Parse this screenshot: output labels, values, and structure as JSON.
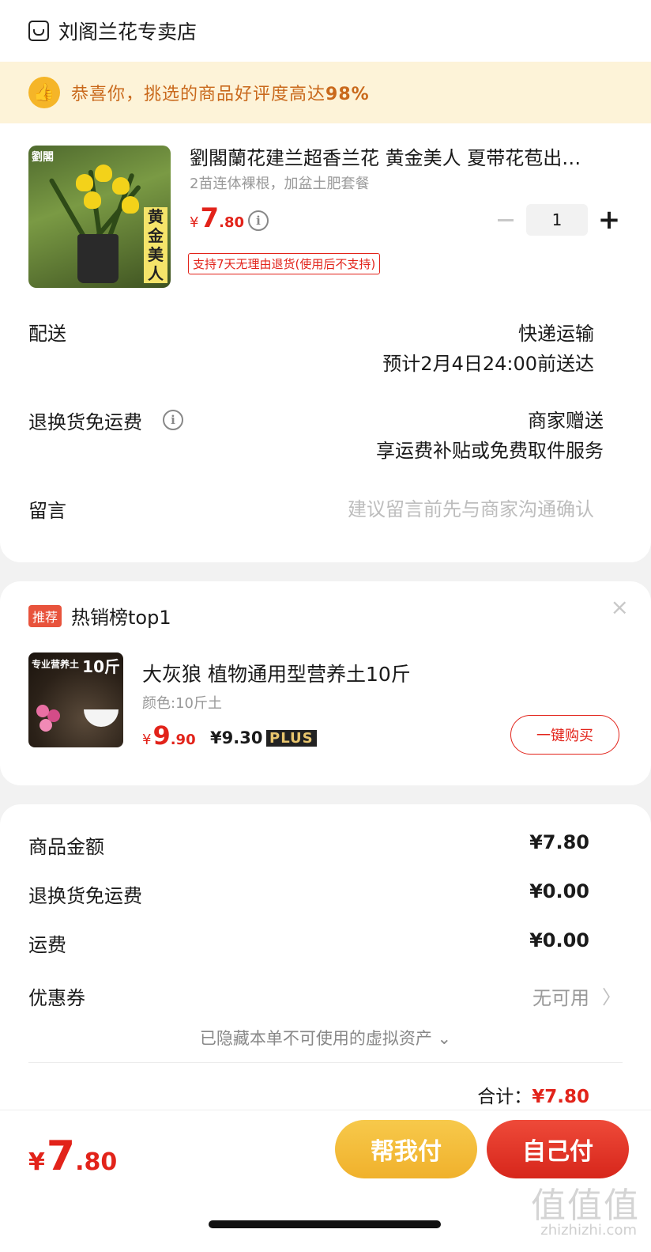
{
  "store": {
    "name": "刘阁兰花专卖店",
    "icon": "store-icon"
  },
  "praise": {
    "text": "恭喜你，挑选的商品好评度高达",
    "percent": "98%",
    "icon": "thumbs-up-icon"
  },
  "product": {
    "title": "劉閣蘭花建兰超香兰花 黄金美人 夏带花苞出…",
    "spec": "2苗连体裸根，加盆土肥套餐",
    "image_logo": "劉閣",
    "image_side_text": "黄金美人",
    "price_yen": "¥",
    "price_int": "7",
    "price_dec": ".80",
    "quantity": "1",
    "return_tag": "支持7天无理由退货(使用后不支持)"
  },
  "delivery": {
    "label": "配送",
    "method": "快递运输",
    "eta": "预计2月4日24:00前送达"
  },
  "return_shipping": {
    "label": "退换货免运费",
    "gift": "商家赠送",
    "desc": "享运费补贴或免费取件服务"
  },
  "message": {
    "label": "留言",
    "placeholder": "建议留言前先与商家沟通确认"
  },
  "recommend": {
    "badge": "推荐",
    "title": "热销榜top1",
    "close": "×",
    "image_banner": "专业营养土",
    "image_big": "10斤",
    "name": "大灰狼 植物通用型营养土10斤",
    "color": "颜色:10斤土",
    "price_yen": "¥",
    "price_int": "9",
    "price_dec": ".90",
    "plus_price": "¥9.30",
    "plus_label": "PLUS",
    "buy_label": "一键购买"
  },
  "summary": {
    "items": [
      {
        "label": "商品金额",
        "value": "¥7.80"
      },
      {
        "label": "退换货免运费",
        "value": "¥0.00"
      },
      {
        "label": "运费",
        "value": "¥0.00"
      }
    ],
    "coupon_label": "优惠券",
    "coupon_value": "无可用",
    "coupon_arrow": "〉",
    "hidden_assets": "已隐藏本单不可使用的虚拟资产 ⌄",
    "total_label": "合计：",
    "total_value": "¥7.80"
  },
  "footer": {
    "price_yen": "¥",
    "price_int": "7",
    "price_dec": ".80",
    "help_pay": "帮我付",
    "self_pay": "自己付"
  },
  "watermark": {
    "text": "值值值",
    "url": "zhizhizhi.com"
  },
  "colors": {
    "accent": "#e2231a",
    "gold": "#f0b12c",
    "praise_bg": "#fdf3d8",
    "praise_text": "#c9691c"
  }
}
